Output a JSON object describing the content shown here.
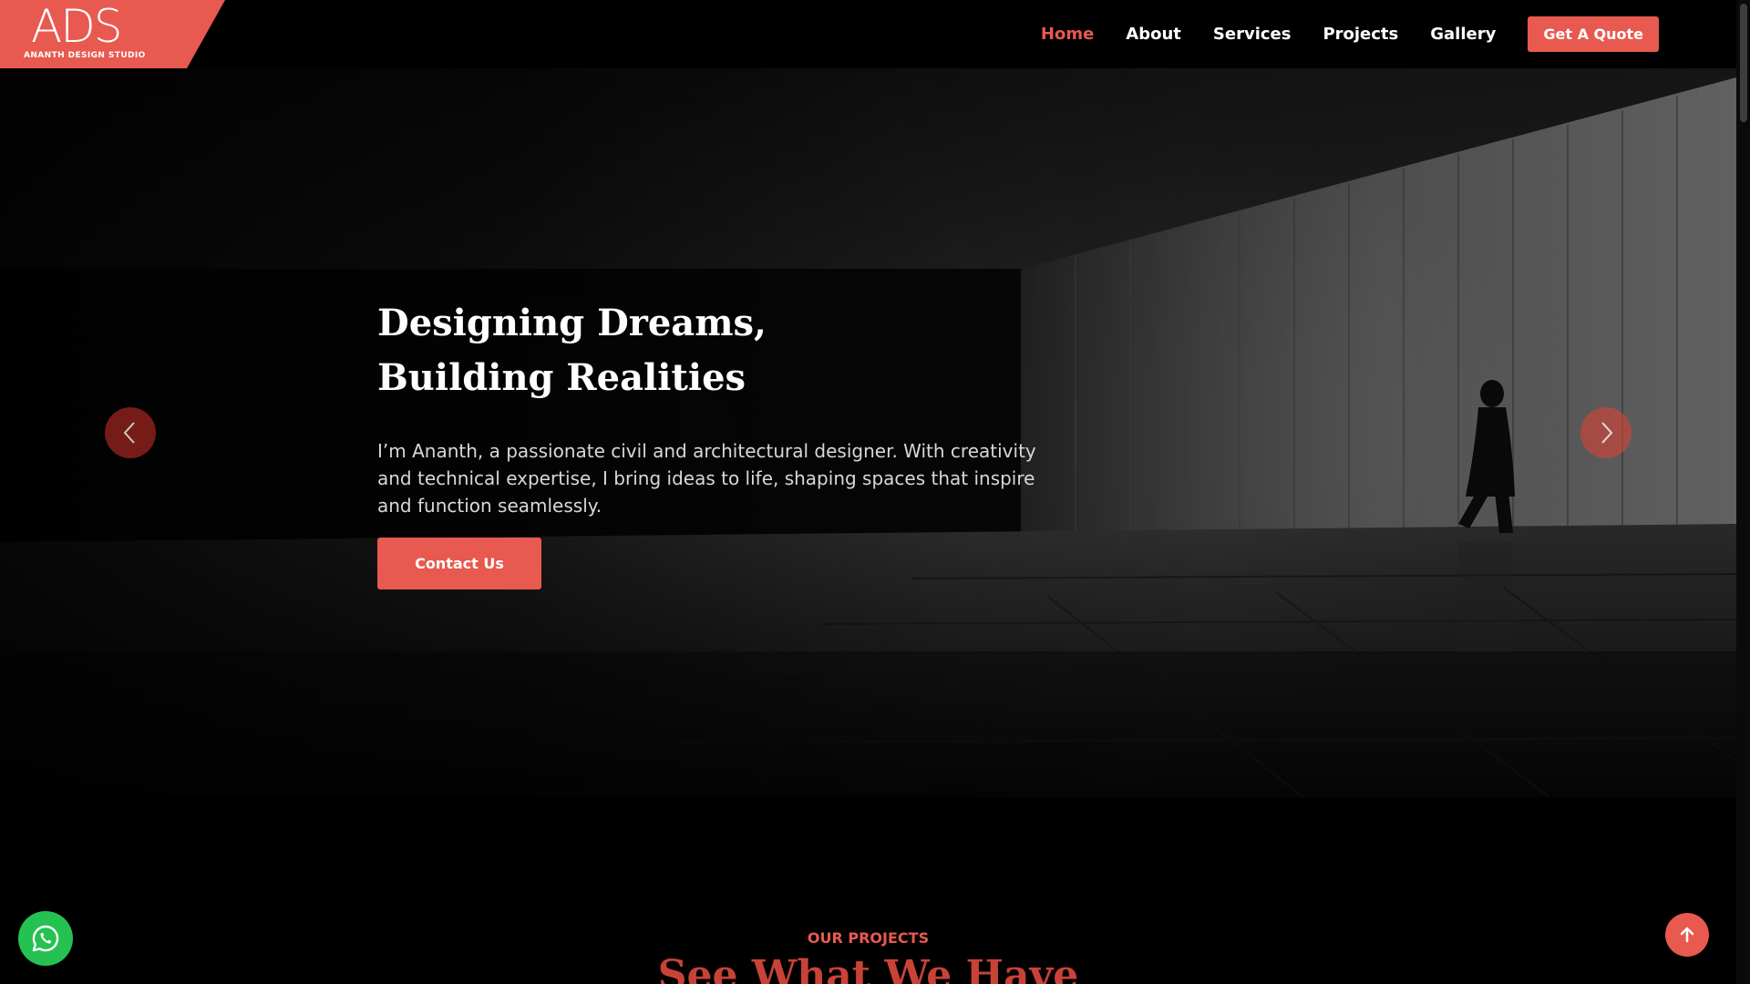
{
  "logo": {
    "mark": "ADS",
    "subtitle": "ANANTH DESIGN STUDIO"
  },
  "nav": {
    "items": [
      {
        "label": "Home",
        "active": true
      },
      {
        "label": "About",
        "active": false
      },
      {
        "label": "Services",
        "active": false
      },
      {
        "label": "Projects",
        "active": false
      },
      {
        "label": "Gallery",
        "active": false
      }
    ],
    "cta_label": "Get A Quote"
  },
  "hero": {
    "title_line1": "Designing Dreams,",
    "title_line2": "Building Realities",
    "description": "I’m Ananth, a passionate civil and architectural designer. With creativity and technical expertise, I bring ideas to life, shaping spaces that inspire and function seamlessly.",
    "button_label": "Contact Us",
    "prev_icon": "chevron-left-icon",
    "next_icon": "chevron-right-icon"
  },
  "projects_section": {
    "label": "OUR PROJECTS",
    "heading": "See What We Have"
  },
  "floating": {
    "whatsapp_icon": "whatsapp-icon",
    "scroll_top_icon": "arrow-up-icon"
  },
  "colors": {
    "accent": "#e8594f",
    "whatsapp": "#25c252",
    "background": "#000000"
  }
}
